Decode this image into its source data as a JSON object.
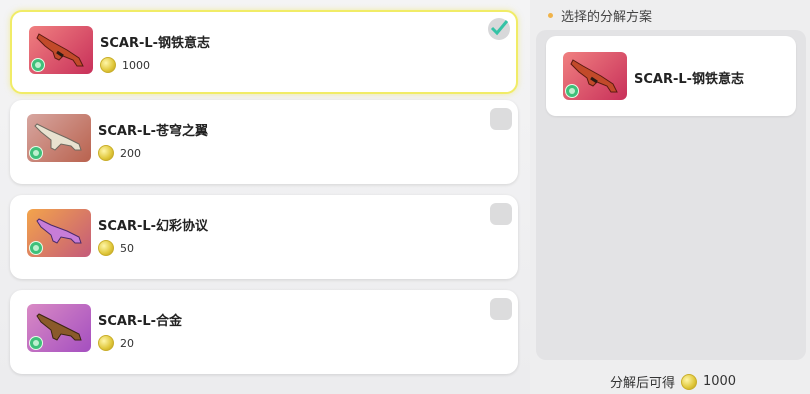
{
  "items": [
    {
      "name": "SCAR-L-钢铁意志",
      "price": "1000",
      "selected": true,
      "colors": [
        "#e56a6a",
        "#c8305a"
      ],
      "gun_color": "#c24a2a"
    },
    {
      "name": "SCAR-L-苍穹之翼",
      "price": "200",
      "selected": false,
      "colors": [
        "#d7a6a0",
        "#b9624e"
      ],
      "gun_color": "#e8e2d0"
    },
    {
      "name": "SCAR-L-幻彩协议",
      "price": "50",
      "selected": false,
      "colors": [
        "#f3a44b",
        "#c45a7a"
      ],
      "gun_color": "#c77dd8"
    },
    {
      "name": "SCAR-L-合金",
      "price": "20",
      "selected": false,
      "colors": [
        "#d98ac4",
        "#a44fc0"
      ],
      "gun_color": "#8a5a2a"
    }
  ],
  "panel": {
    "title": "选择的分解方案",
    "selected_item": "SCAR-L-钢铁意志"
  },
  "footer": {
    "label": "分解后可得",
    "amount": "1000"
  }
}
